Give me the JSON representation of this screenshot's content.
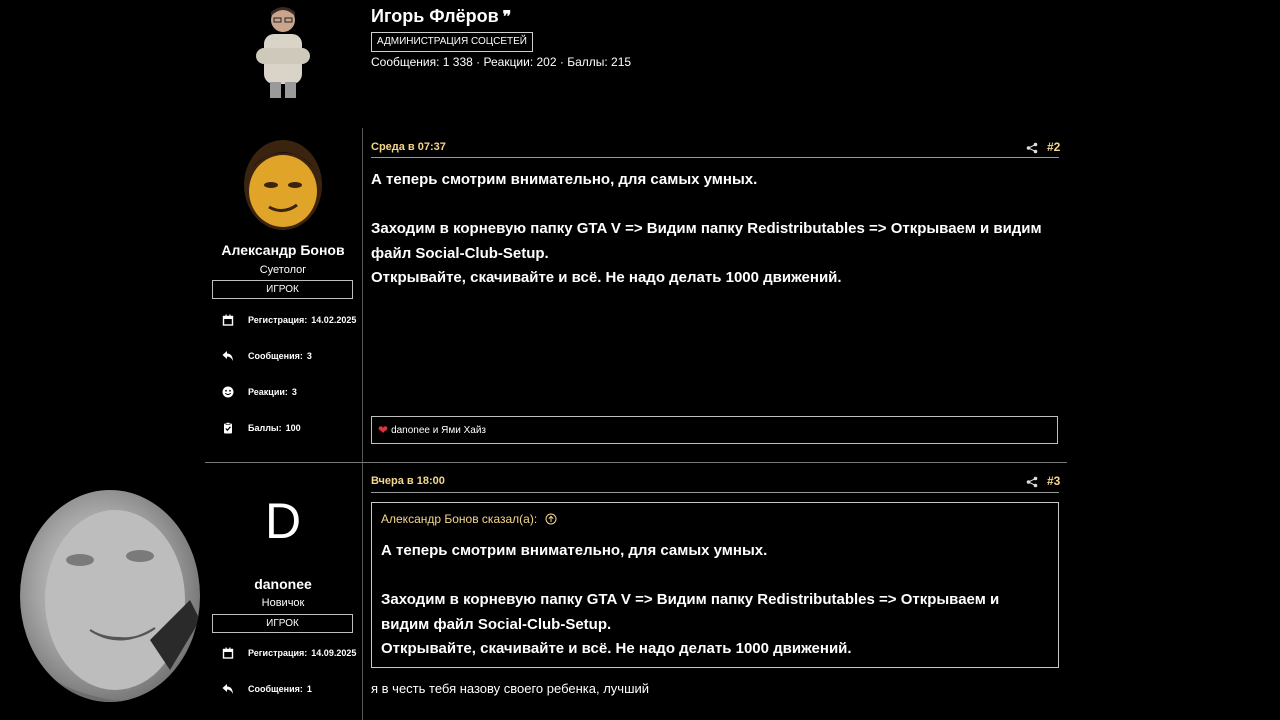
{
  "top_author": {
    "name": "Игорь Флёров",
    "quote_mark": "❞",
    "badge": "АДМИНИСТРАЦИЯ СОЦСЕТЕЙ",
    "stats": "Сообщения: 1 338 · Реакции: 202 · Баллы: 215"
  },
  "post2": {
    "date": "Среда в 07:37",
    "number": "#2",
    "author": {
      "name": "Александр Бонов",
      "title": "Суетолог",
      "role": "ИГРОК",
      "stats": [
        {
          "icon": "calendar-icon",
          "label": "Регистрация:",
          "value": "14.02.2025"
        },
        {
          "icon": "reply-icon",
          "label": "Сообщения:",
          "value": "3"
        },
        {
          "icon": "smile-icon",
          "label": "Реакции:",
          "value": "3"
        },
        {
          "icon": "clipboard-icon",
          "label": "Баллы:",
          "value": "100"
        }
      ]
    },
    "body": [
      "А теперь смотрим внимательно, для самых умных.",
      "",
      "Заходим в корневую папку GTA V => Видим папку Redistributables => Открываем и видим файл Social-Club-Setup.",
      "Открывайте, скачивайте и всё. Не надо делать 1000 движений."
    ],
    "reactions": "danonee и Ями Хайз"
  },
  "post3": {
    "date": "Вчера в 18:00",
    "number": "#3",
    "author": {
      "initial": "D",
      "name": "danonee",
      "title": "Новичок",
      "role": "ИГРОК",
      "stats": [
        {
          "icon": "calendar-icon",
          "label": "Регистрация:",
          "value": "14.09.2025"
        },
        {
          "icon": "reply-icon",
          "label": "Сообщения:",
          "value": "1"
        }
      ]
    },
    "quote": {
      "header": "Александр Бонов сказал(а):",
      "body": [
        "А теперь смотрим внимательно, для самых умных.",
        "",
        "Заходим в корневую папку GTA V => Видим папку Redistributables => Открываем и видим файл Social-Club-Setup.",
        "Открывайте, скачивайте и всё. Не надо делать 1000 движений."
      ]
    },
    "reply": "я в честь тебя назову своего ребенка, лучший"
  },
  "colors": {
    "accent": "#f5d78c",
    "heart": "#e0323c",
    "background": "#000000"
  }
}
